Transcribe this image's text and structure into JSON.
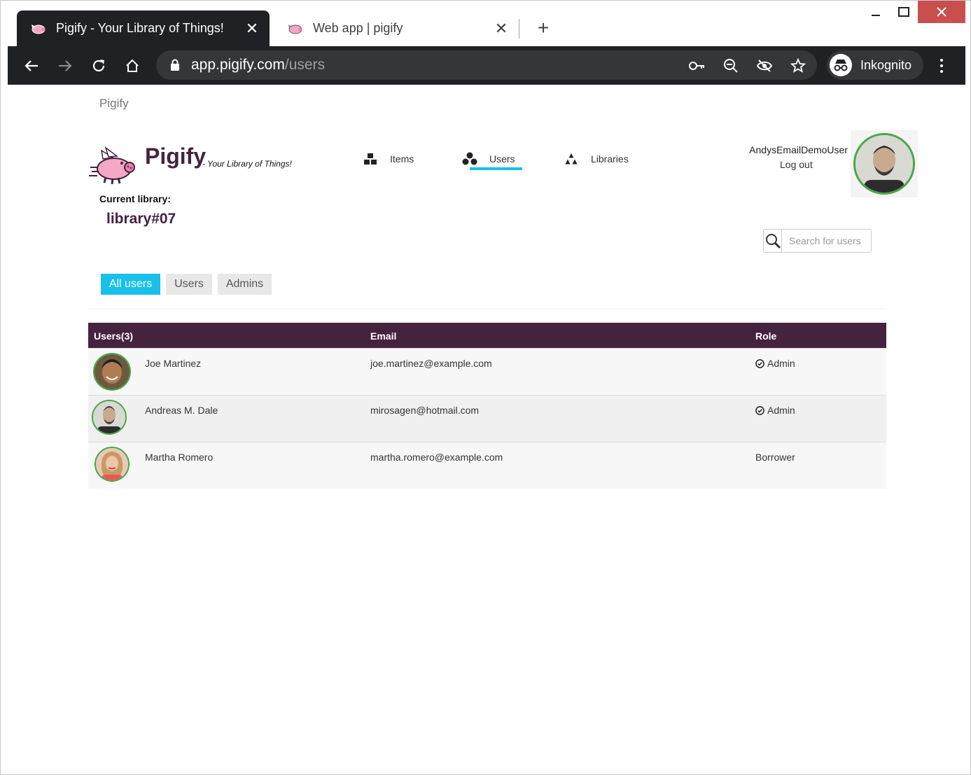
{
  "browser": {
    "tabs": [
      {
        "title": "Pigify - Your Library of Things!",
        "active": true
      },
      {
        "title": "Web app | pigify",
        "active": false
      }
    ],
    "url_host": "app.pigify.com",
    "url_path": "/users",
    "profile_label": "Inkognito"
  },
  "page": {
    "site_name": "Pigify",
    "brand": "Pigify",
    "tagline": "- Your Library of Things!",
    "current_library_label": "Current library:",
    "current_library": "library#07",
    "nav": [
      {
        "label": "Items",
        "icon": "blocks-icon"
      },
      {
        "label": "Users",
        "icon": "users-icon",
        "active": true
      },
      {
        "label": "Libraries",
        "icon": "libraries-icon"
      }
    ],
    "user": {
      "name": "AndysEmailDemoUser",
      "logout": "Log out"
    },
    "search": {
      "placeholder": "Search for users"
    },
    "filters": [
      {
        "label": "All users",
        "active": true
      },
      {
        "label": "Users",
        "active": false
      },
      {
        "label": "Admins",
        "active": false
      }
    ],
    "table": {
      "headers": [
        "Users(3)",
        "Email",
        "Role"
      ],
      "rows": [
        {
          "name": "Joe Martinez",
          "email": "joe.martinez@example.com",
          "role": "Admin",
          "is_admin": true
        },
        {
          "name": "Andreas M. Dale",
          "email": "mirosagen@hotmail.com",
          "role": "Admin",
          "is_admin": true
        },
        {
          "name": "Martha Romero",
          "email": "martha.romero@example.com",
          "role": "Borrower",
          "is_admin": false
        }
      ]
    }
  },
  "colors": {
    "accent": "#18c0ea",
    "brand": "#45233f",
    "avatar_ring": "#4aa64a",
    "chrome_dark": "#202124",
    "close_red": "#c94f4f"
  }
}
